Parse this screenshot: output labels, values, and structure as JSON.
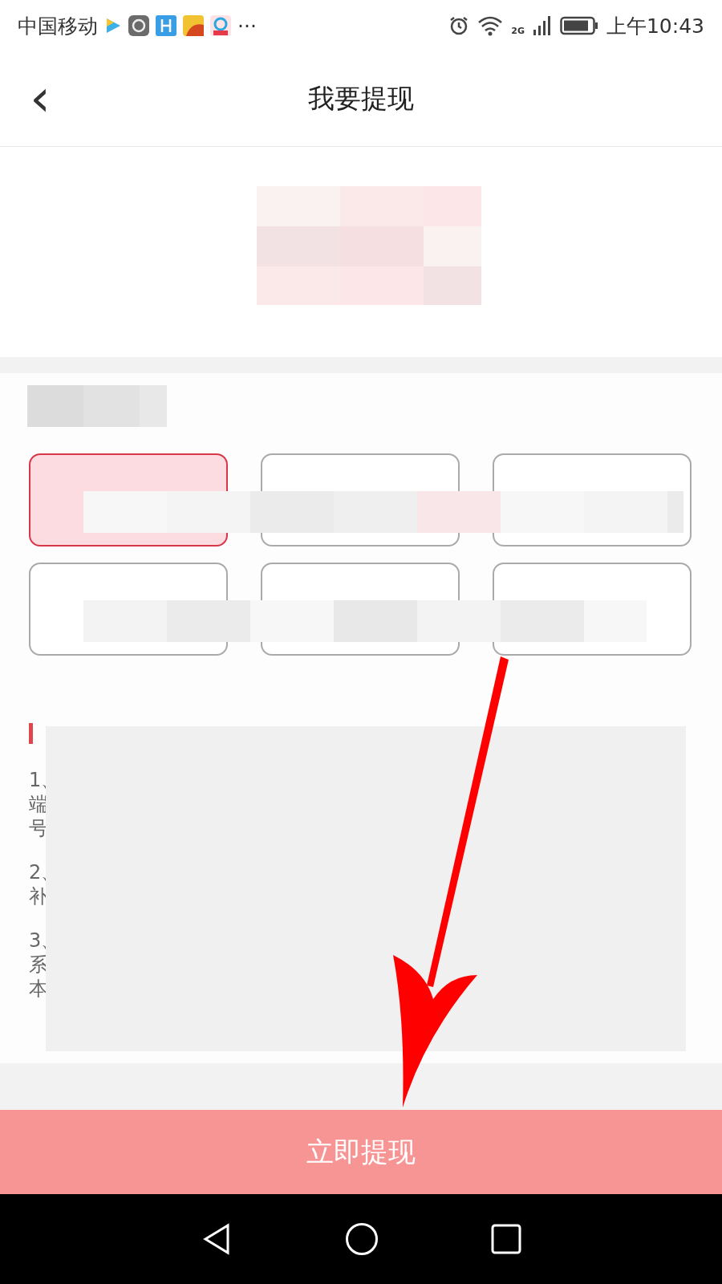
{
  "status_bar": {
    "carrier": "中国移动",
    "more": "···",
    "network": "2G",
    "time": "上午10:43"
  },
  "header": {
    "back": "‹",
    "title": "我要提现"
  },
  "amount_options": [
    {
      "selected": true
    },
    {
      "selected": false
    },
    {
      "selected": false
    },
    {
      "selected": false
    },
    {
      "selected": false
    },
    {
      "selected": false
    }
  ],
  "notes": {
    "items": [
      {
        "lines": [
          "1、",
          "端",
          "号"
        ]
      },
      {
        "lines": [
          "2、",
          "补"
        ]
      },
      {
        "lines": [
          "3、",
          "系",
          "本"
        ]
      }
    ]
  },
  "submit_button": {
    "label": "立即提现"
  }
}
